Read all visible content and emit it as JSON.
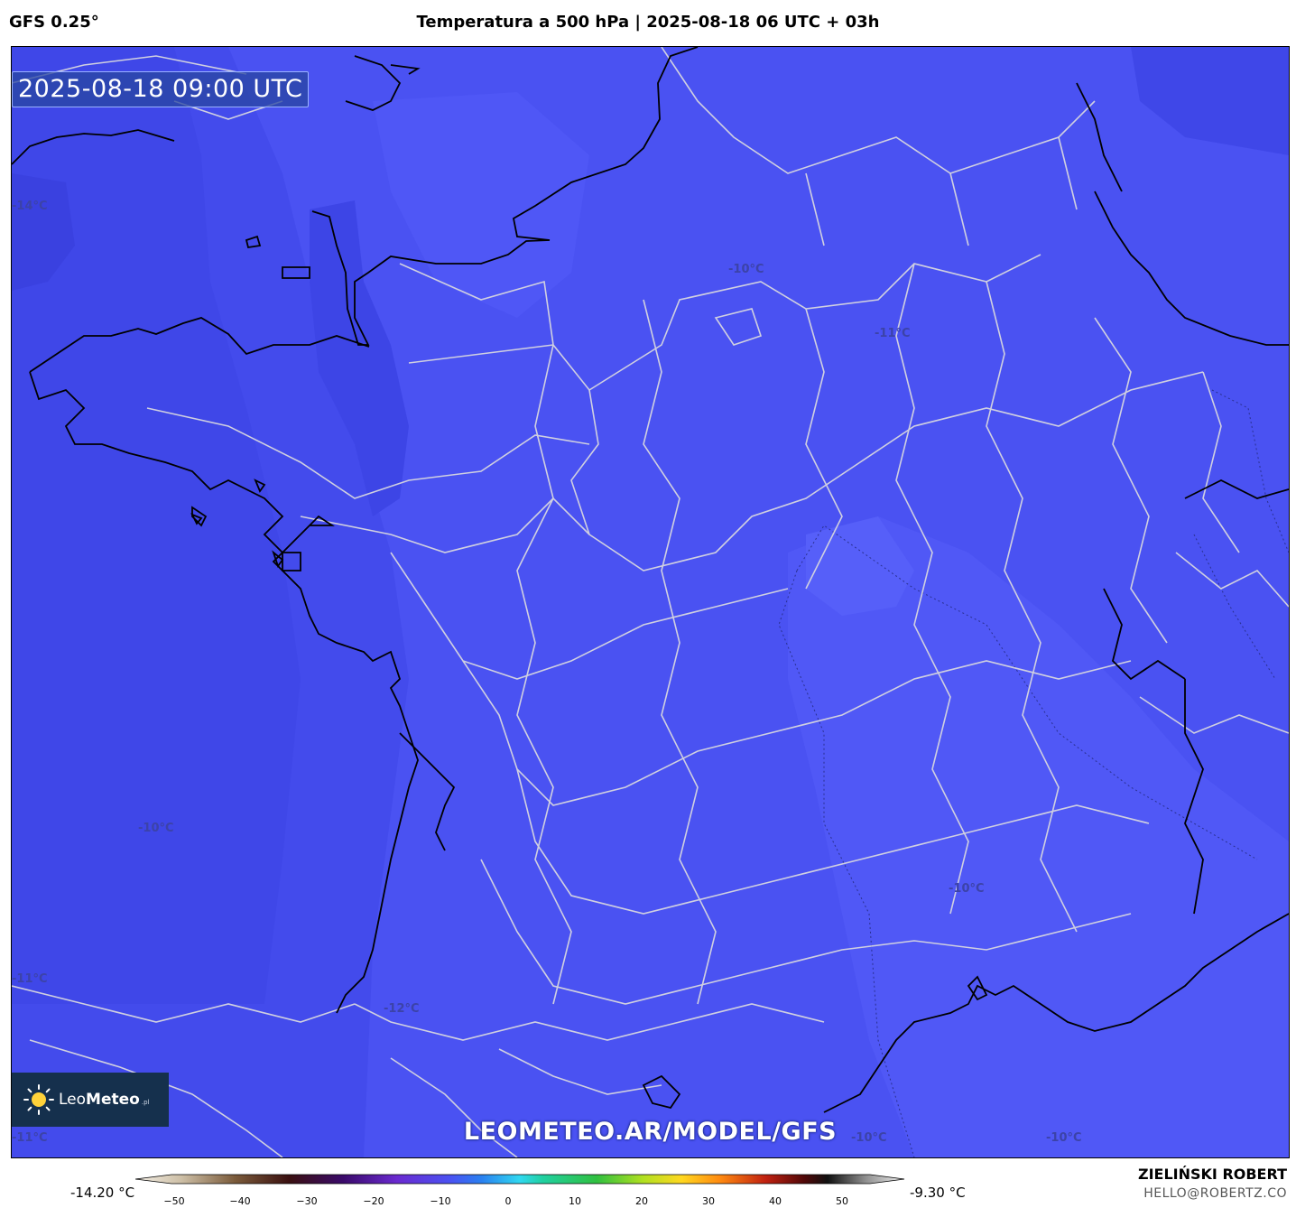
{
  "header": {
    "model": "GFS 0.25°",
    "title": "Temperatura a 500 hPa | 2025-08-18 06 UTC + 03h"
  },
  "map": {
    "valid_time": "2025-08-18 09:00 UTC",
    "iso_labels": [
      "-14°C",
      "-10°C",
      "-11°C",
      "-10°C",
      "-10°C",
      "-11°C",
      "-12°C",
      "-11°C",
      "-10°C",
      "-10°C"
    ],
    "watermark": "LEOMETEO.AR/MODEL/GFS",
    "colors": {
      "field_main": "#4a52f2",
      "field_cold": "#3e46e6",
      "field_warm": "#5660f8",
      "borders": "#c8c8d8",
      "coast": "#000000"
    }
  },
  "logo": {
    "brand_light": "Leo",
    "brand_bold": "Meteo",
    "suffix": ".pl"
  },
  "colorbar": {
    "min_label": "-14.20 °C",
    "max_label": "-9.30 °C",
    "ticks": [
      "−50",
      "−40",
      "−30",
      "−20",
      "−10",
      "0",
      "10",
      "20",
      "30",
      "40",
      "50"
    ]
  },
  "credit": {
    "name": "ZIELIŃSKI ROBERT",
    "email": "HELLO@ROBERTZ.CO"
  }
}
